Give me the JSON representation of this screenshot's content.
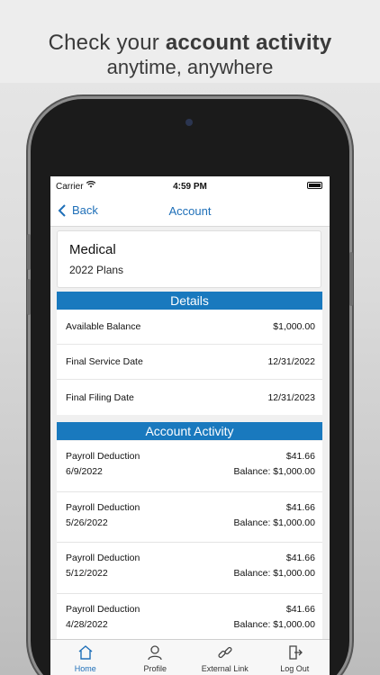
{
  "promo": {
    "line1_prefix": "Check your ",
    "line1_bold": "account activity",
    "line2": "anytime, anywhere"
  },
  "status_bar": {
    "carrier": "Carrier",
    "time": "4:59 PM"
  },
  "nav": {
    "back_label": "Back",
    "title": "Account"
  },
  "plan": {
    "name": "Medical",
    "subtitle": "2022 Plans"
  },
  "details": {
    "header": "Details",
    "rows": [
      {
        "label": "Available Balance",
        "value": "$1,000.00"
      },
      {
        "label": "Final Service Date",
        "value": "12/31/2022"
      },
      {
        "label": "Final Filing Date",
        "value": "12/31/2023"
      }
    ]
  },
  "activity": {
    "header": "Account Activity",
    "items": [
      {
        "description": "Payroll Deduction",
        "date": "6/9/2022",
        "amount": "$41.66",
        "balance": "Balance: $1,000.00"
      },
      {
        "description": "Payroll Deduction",
        "date": "5/26/2022",
        "amount": "$41.66",
        "balance": "Balance: $1,000.00"
      },
      {
        "description": "Payroll Deduction",
        "date": "5/12/2022",
        "amount": "$41.66",
        "balance": "Balance: $1,000.00"
      },
      {
        "description": "Payroll Deduction",
        "date": "4/28/2022",
        "amount": "$41.66",
        "balance": "Balance: $1,000.00"
      }
    ]
  },
  "tabs": [
    {
      "label": "Home",
      "icon": "home-icon"
    },
    {
      "label": "Profile",
      "icon": "profile-icon"
    },
    {
      "label": "External Link",
      "icon": "link-icon"
    },
    {
      "label": "Log Out",
      "icon": "logout-icon"
    }
  ],
  "colors": {
    "accent": "#1e6fb8",
    "section_header": "#1979be"
  }
}
